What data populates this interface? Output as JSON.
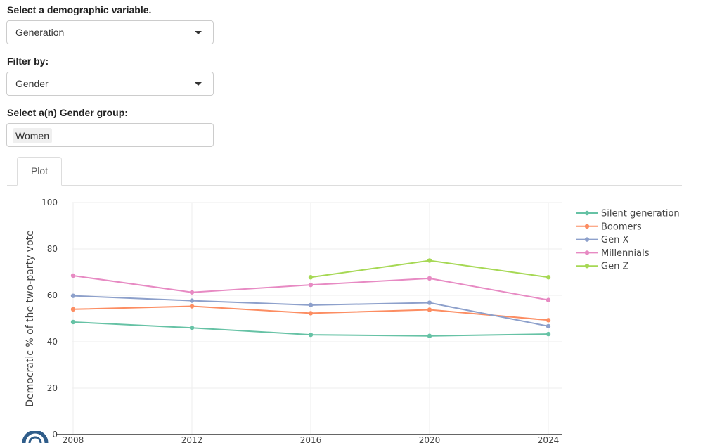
{
  "controls": {
    "demographic_label": "Select a demographic variable.",
    "demographic_value": "Generation",
    "filter_label": "Filter by:",
    "filter_value": "Gender",
    "group_label": "Select a(n) Gender group:",
    "group_tags": [
      "Women"
    ]
  },
  "tabs": [
    {
      "label": "Plot",
      "active": true
    }
  ],
  "chart_data": {
    "type": "line",
    "title": "",
    "xlabel": "",
    "ylabel": "Democratic % of the two-party vote",
    "x": [
      2008,
      2012,
      2016,
      2020,
      2024
    ],
    "x_ticks": [
      "2008",
      "2012",
      "2016",
      "2020",
      "2024"
    ],
    "y_ticks": [
      "0",
      "20",
      "40",
      "60",
      "80",
      "100"
    ],
    "ylim": [
      0,
      100
    ],
    "grid": true,
    "legend_position": "top-right",
    "series": [
      {
        "name": "Silent generation",
        "color": "#66c2a5",
        "values": [
          48.5,
          46.0,
          43.0,
          42.5,
          43.3
        ]
      },
      {
        "name": "Boomers",
        "color": "#fc8d62",
        "values": [
          54.0,
          55.3,
          52.3,
          53.8,
          49.3
        ]
      },
      {
        "name": "Gen X",
        "color": "#8da0cb",
        "values": [
          59.8,
          57.7,
          55.8,
          56.8,
          46.7
        ]
      },
      {
        "name": "Millennials",
        "color": "#e78ac3",
        "values": [
          68.5,
          61.3,
          64.5,
          67.3,
          58.0
        ]
      },
      {
        "name": "Gen Z",
        "color": "#a6d854",
        "values": [
          null,
          null,
          67.8,
          75.0,
          67.8
        ]
      }
    ]
  }
}
